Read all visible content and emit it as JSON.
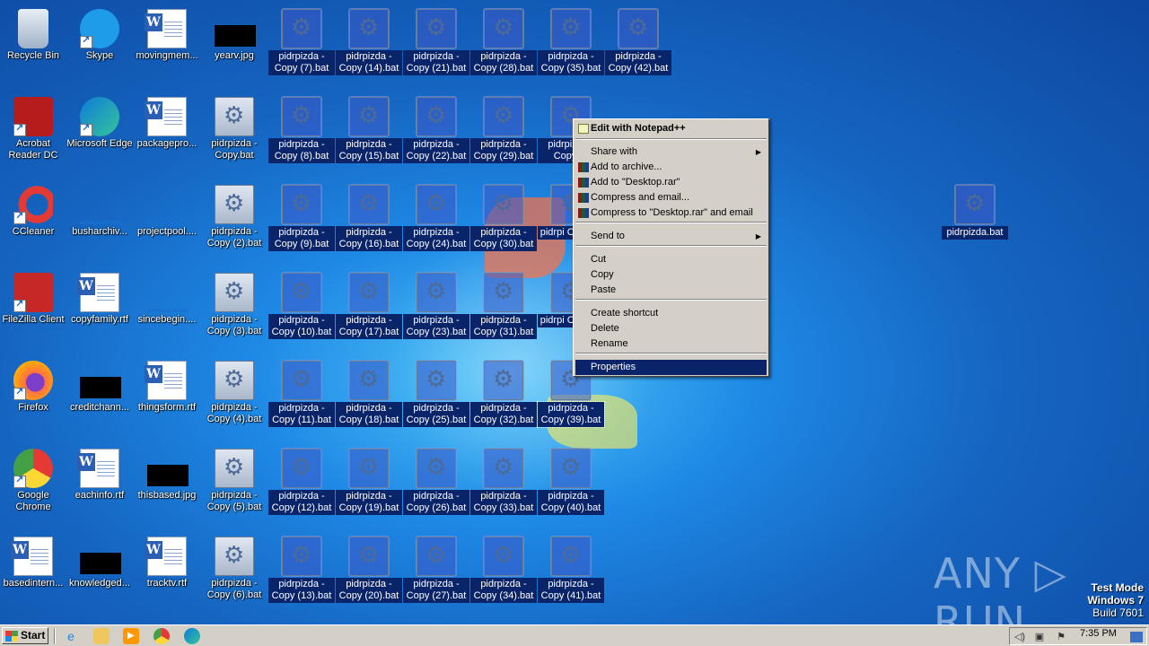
{
  "desktop": {
    "col1": [
      {
        "label": "Recycle Bin",
        "icon": "recycle-bin-icon"
      },
      {
        "label": "Acrobat Reader DC",
        "icon": "acrobat-icon"
      },
      {
        "label": "CCleaner",
        "icon": "ccleaner-icon"
      },
      {
        "label": "FileZilla Client",
        "icon": "filezilla-icon"
      },
      {
        "label": "Firefox",
        "icon": "firefox-icon"
      },
      {
        "label": "Google Chrome",
        "icon": "chrome-icon"
      },
      {
        "label": "basedintern...",
        "icon": "word-doc-icon"
      }
    ],
    "col2": [
      {
        "label": "Skype",
        "icon": "skype-icon"
      },
      {
        "label": "Microsoft Edge",
        "icon": "edge-icon"
      },
      {
        "label": "busharchiv...",
        "icon": "file-icon"
      },
      {
        "label": "copyfamily.rtf",
        "icon": "word-doc-icon"
      },
      {
        "label": "creditchann...",
        "icon": "image-thumb-icon"
      },
      {
        "label": "eachinfo.rtf",
        "icon": "word-doc-icon"
      },
      {
        "label": "knowledged...",
        "icon": "image-thumb-icon"
      }
    ],
    "col3": [
      {
        "label": "movingmem...",
        "icon": "word-doc-icon"
      },
      {
        "label": "packagepro...",
        "icon": "word-doc-icon"
      },
      {
        "label": "projectpool....",
        "icon": "file-icon"
      },
      {
        "label": "sincebegin....",
        "icon": "file-icon"
      },
      {
        "label": "thingsform.rtf",
        "icon": "word-doc-icon"
      },
      {
        "label": "thisbased.jpg",
        "icon": "image-thumb-icon"
      },
      {
        "label": "tracktv.rtf",
        "icon": "word-doc-icon"
      }
    ],
    "col4": [
      {
        "label": "yearv.jpg",
        "icon": "image-thumb-icon"
      },
      {
        "label": "pidrpizda - Copy.bat",
        "icon": "batch-file-icon"
      },
      {
        "label": "pidrpizda - Copy (2).bat",
        "icon": "batch-file-icon"
      },
      {
        "label": "pidrpizda - Copy (3).bat",
        "icon": "batch-file-icon"
      },
      {
        "label": "pidrpizda - Copy (4).bat",
        "icon": "batch-file-icon"
      },
      {
        "label": "pidrpizda - Copy (5).bat",
        "icon": "batch-file-icon"
      },
      {
        "label": "pidrpizda - Copy (6).bat",
        "icon": "batch-file-icon"
      }
    ],
    "col5": [
      "pidrpizda - Copy (7).bat",
      "pidrpizda - Copy (8).bat",
      "pidrpizda - Copy (9).bat",
      "pidrpizda - Copy (10).bat",
      "pidrpizda - Copy (11).bat",
      "pidrpizda - Copy (12).bat",
      "pidrpizda - Copy (13).bat"
    ],
    "col6": [
      "pidrpizda - Copy (14).bat",
      "pidrpizda - Copy (15).bat",
      "pidrpizda - Copy (16).bat",
      "pidrpizda - Copy (17).bat",
      "pidrpizda - Copy (18).bat",
      "pidrpizda - Copy (19).bat",
      "pidrpizda - Copy (20).bat"
    ],
    "col7": [
      "pidrpizda - Copy (21).bat",
      "pidrpizda - Copy (22).bat",
      "pidrpizda - Copy (24).bat",
      "pidrpizda - Copy (23).bat",
      "pidrpizda - Copy (25).bat",
      "pidrpizda - Copy (26).bat",
      "pidrpizda - Copy (27).bat"
    ],
    "col8": [
      "pidrpizda - Copy (28).bat",
      "pidrpizda - Copy (29).bat",
      "pidrpizda - Copy (30).bat",
      "pidrpizda - Copy (31).bat",
      "pidrpizda - Copy (32).bat",
      "pidrpizda - Copy (33).bat",
      "pidrpizda - Copy (34).bat"
    ],
    "col9": [
      "pidrpizda - Copy (35).bat",
      "pidrpizda - Copy (3",
      "pidrpi Copy (3",
      "pidrpi Copy (3",
      "pidrpizda - Copy (39).bat",
      "pidrpizda - Copy (40).bat",
      "pidrpizda - Copy (41).bat"
    ],
    "col10": [
      "pidrpizda - Copy (42).bat"
    ],
    "far": {
      "label": "pidrpizda.bat",
      "icon": "batch-file-icon"
    }
  },
  "context_menu": {
    "items": [
      {
        "label": "Edit with Notepad++",
        "icon": "notepadpp-icon",
        "bold": true
      },
      {
        "label": "Share with",
        "submenu": true
      },
      {
        "label": "Add to archive...",
        "icon": "winrar-icon"
      },
      {
        "label": "Add to \"Desktop.rar\"",
        "icon": "winrar-icon"
      },
      {
        "label": "Compress and email...",
        "icon": "winrar-icon"
      },
      {
        "label": "Compress to \"Desktop.rar\" and email",
        "icon": "winrar-icon"
      },
      {
        "label": "Send to",
        "submenu": true
      },
      {
        "label": "Cut"
      },
      {
        "label": "Copy"
      },
      {
        "label": "Paste"
      },
      {
        "label": "Create shortcut"
      },
      {
        "label": "Delete"
      },
      {
        "label": "Rename"
      },
      {
        "label": "Properties",
        "highlighted": true
      }
    ]
  },
  "taskbar": {
    "start_label": "Start",
    "quick_launch": [
      "ie-icon",
      "explorer-icon",
      "media-player-icon",
      "chrome-icon",
      "edge-icon"
    ],
    "clock": "7:35 PM"
  },
  "watermark": "ANY ▷ RUN",
  "test_mode": {
    "line1": "Test Mode",
    "line2": "Windows 7",
    "line3": "Build 7601"
  },
  "colors": {
    "selection": "#0a246a",
    "menu_bg": "#d4d0c8",
    "desktop": "#1565c0"
  }
}
